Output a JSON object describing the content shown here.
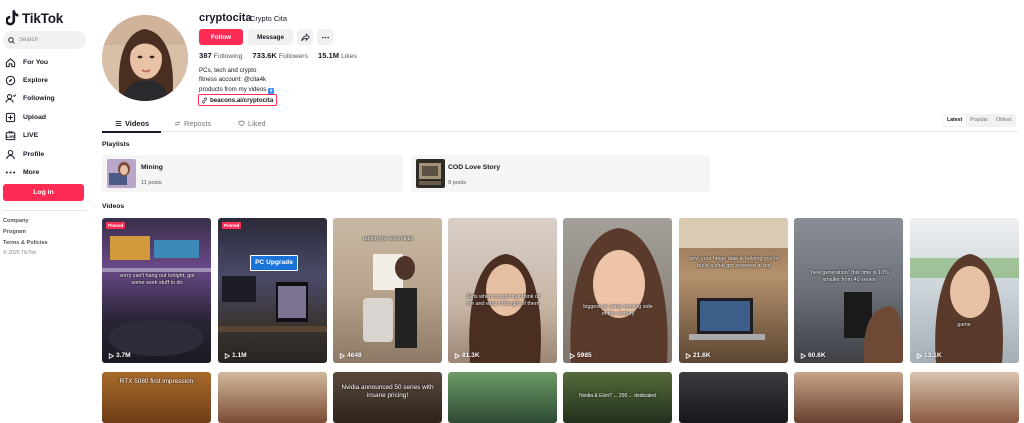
{
  "app": {
    "name": "TikTok"
  },
  "sidebar": {
    "search_placeholder": "Search",
    "nav": [
      {
        "label": "For You",
        "icon": "home-icon"
      },
      {
        "label": "Explore",
        "icon": "compass-icon"
      },
      {
        "label": "Following",
        "icon": "following-icon"
      },
      {
        "label": "Upload",
        "icon": "upload-icon"
      },
      {
        "label": "LIVE",
        "icon": "live-icon"
      },
      {
        "label": "Profile",
        "icon": "profile-icon"
      },
      {
        "label": "More",
        "icon": "more-icon"
      }
    ],
    "login_label": "Log in",
    "footer_links": [
      "Company",
      "Program",
      "Terms & Policies"
    ],
    "copyright": "© 2025 TikTok"
  },
  "profile": {
    "username": "cryptocita",
    "nickname": "Crypto Cita",
    "follow_label": "Follow",
    "message_label": "Message",
    "stats": {
      "following": "387",
      "following_label": "Following",
      "followers": "733.6K",
      "followers_label": "Followers",
      "likes": "15.1M",
      "likes_label": "Likes"
    },
    "bio": [
      "PCs, tech and crypto",
      "fitness account: @cita4k",
      "products from my videos"
    ],
    "link": "beacons.ai/cryptocita"
  },
  "tabs": [
    {
      "label": "Videos",
      "icon": "grid-icon"
    },
    {
      "label": "Reposts",
      "icon": "repost-icon"
    },
    {
      "label": "Liked",
      "icon": "heart-icon"
    }
  ],
  "sort_options": [
    "Latest",
    "Popular",
    "Oldest"
  ],
  "playlists_title": "Playlists",
  "playlists": [
    {
      "name": "Mining",
      "count": "11 posts"
    },
    {
      "name": "COD Love Story",
      "count": "9 posts"
    }
  ],
  "videos_title": "Videos",
  "videos": [
    {
      "views": "3.7M",
      "pinned": "Pinned",
      "caption": "sorry can't hang out tonight, got some work stuff to do"
    },
    {
      "views": "1.1M",
      "pinned": "Pinned",
      "badge": "PC Upgrade"
    },
    {
      "views": "4648",
      "caption": "rapidly the essentials"
    },
    {
      "views": "81.3K",
      "caption": "Girls when brands that think of me and what I thought of them"
    },
    {
      "views": "5985",
      "caption": "biggest pc setup moving side of the century"
    },
    {
      "views": "21.6K",
      "caption": "pov: your hinge date is helping you to build a chat gpt powered ai bot"
    },
    {
      "views": "60.6K",
      "caption": "\"new generation\" this time is 10% smaller from 40 series"
    },
    {
      "views": "13.1K",
      "caption": "game"
    }
  ],
  "videos_row2": [
    {
      "caption": "RTX 5080 first impression"
    },
    {
      "caption": ""
    },
    {
      "caption": "Nvidia announced 50 series with insane pricing!"
    },
    {
      "caption": ""
    },
    {
      "caption": "Nvidia & Elon? ... 200 ... dedicated"
    },
    {
      "caption": ""
    },
    {
      "caption": ""
    },
    {
      "caption": ""
    }
  ],
  "colors": {
    "brand": "#fe2c55",
    "text": "#161823",
    "muted": "#73747b"
  }
}
